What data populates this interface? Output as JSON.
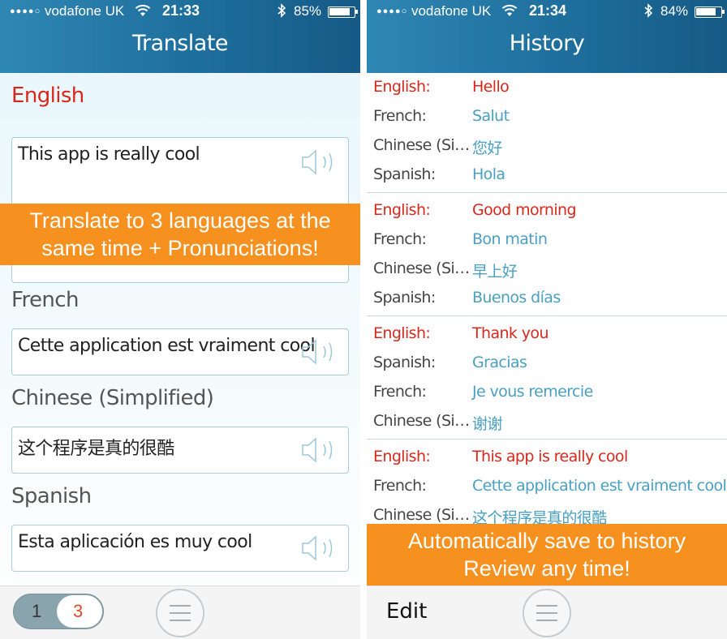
{
  "left_screen": {
    "status": {
      "carrier": "vodafone UK",
      "signal_dots": "●●●●○",
      "time": "21:33",
      "battery": "85%",
      "battery_level": 0.85
    },
    "title": "Translate",
    "source": {
      "language": "English",
      "text": "This app is really cool"
    },
    "banner": {
      "line1": "Translate to 3 languages at the",
      "line2": "same time + Pronunciations!"
    },
    "targets": [
      {
        "language": "French",
        "text": "Cette application est vraiment cool"
      },
      {
        "language": "Chinese (Simplified)",
        "text": "这个程序是真的很酷"
      },
      {
        "language": "Spanish",
        "text": "Esta aplicación es muy cool"
      }
    ],
    "page_toggle": {
      "inactive": "1",
      "active": "3"
    }
  },
  "right_screen": {
    "status": {
      "carrier": "vodafone UK",
      "signal_dots": "●●●●○",
      "time": "21:34",
      "battery": "84%",
      "battery_level": 0.84
    },
    "title": "History",
    "entries": [
      {
        "rows": [
          {
            "lang": "English:",
            "text": "Hello",
            "source": true
          },
          {
            "lang": "French:",
            "text": "Salut"
          },
          {
            "lang": "Chinese (Si…",
            "text": "您好"
          },
          {
            "lang": "Spanish:",
            "text": "Hola"
          }
        ]
      },
      {
        "rows": [
          {
            "lang": "English:",
            "text": "Good morning",
            "source": true
          },
          {
            "lang": "French:",
            "text": "Bon matin"
          },
          {
            "lang": "Chinese (Si…",
            "text": "早上好"
          },
          {
            "lang": "Spanish:",
            "text": "Buenos días"
          }
        ]
      },
      {
        "rows": [
          {
            "lang": "English:",
            "text": "Thank you",
            "source": true
          },
          {
            "lang": "Spanish:",
            "text": "Gracias"
          },
          {
            "lang": "French:",
            "text": "Je vous remercie"
          },
          {
            "lang": "Chinese (Si…",
            "text": "谢谢"
          }
        ]
      },
      {
        "rows": [
          {
            "lang": "English:",
            "text": "This app is really cool",
            "source": true
          },
          {
            "lang": "French:",
            "text": "Cette application est vraiment cool"
          },
          {
            "lang": "Chinese (Si…",
            "text": "这个程序是真的很酷"
          }
        ]
      }
    ],
    "banner": {
      "line1": "Automatically save to history",
      "line2": "Review any time!"
    },
    "edit_label": "Edit"
  },
  "colors": {
    "accent_red": "#d9281b",
    "link_blue": "#4aa0c2",
    "banner_orange": "#f6901e",
    "nav_blue": "#1e6e9c"
  },
  "icons": [
    "wifi-icon",
    "bluetooth-icon",
    "battery-icon",
    "speaker-icon",
    "menu-icon"
  ]
}
